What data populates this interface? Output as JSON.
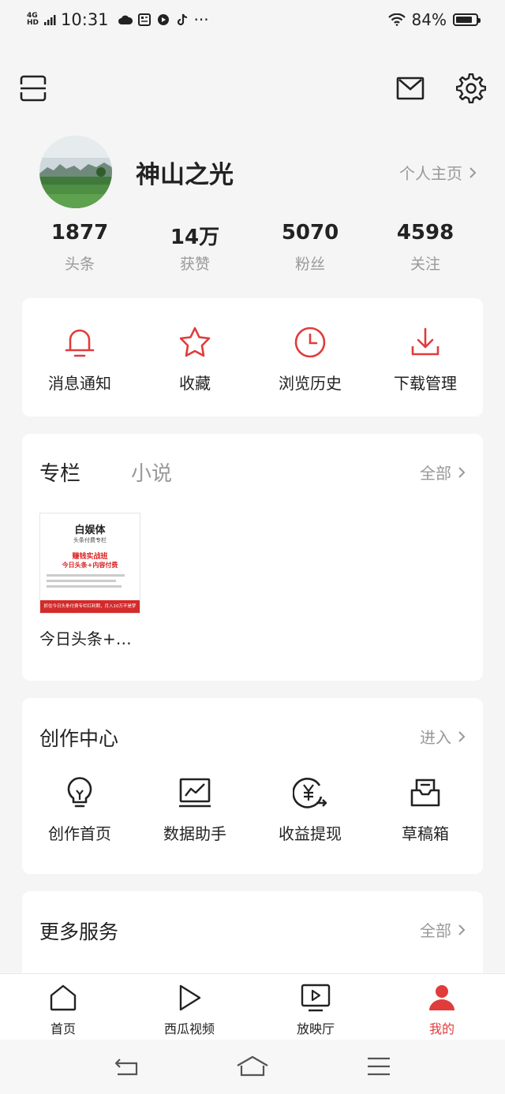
{
  "status_bar": {
    "network": "4G",
    "network_sub": "HD",
    "time": "10:31",
    "more": "···",
    "battery": "84%",
    "battery_level": 0.84
  },
  "header": {
    "left_icon": "scan-icon",
    "mail_icon": "mail-icon",
    "settings_icon": "gear-icon"
  },
  "profile": {
    "name": "神山之光",
    "homepage_label": "个人主页",
    "stats": [
      {
        "value": "1877",
        "label": "头条"
      },
      {
        "value": "14万",
        "label": "获赞"
      },
      {
        "value": "5070",
        "label": "粉丝"
      },
      {
        "value": "4598",
        "label": "关注"
      }
    ]
  },
  "quick_actions": [
    {
      "label": "消息通知",
      "icon": "bell-icon"
    },
    {
      "label": "收藏",
      "icon": "star-icon"
    },
    {
      "label": "浏览历史",
      "icon": "clock-icon"
    },
    {
      "label": "下载管理",
      "icon": "download-icon"
    }
  ],
  "column_card": {
    "tab_active": "专栏",
    "tab_inactive": "小说",
    "all_label": "全部",
    "book": {
      "title": "今日头条+…",
      "cover_brand": "白娱体",
      "cover_sub": "头条付费专栏",
      "cover_heading1": "赚钱实战班",
      "cover_heading2": "今日头条+内容付费",
      "cover_footer": "抓住今日头条付费专栏红利期，月入10万不是梦"
    }
  },
  "creator_center": {
    "title": "创作中心",
    "enter_label": "进入",
    "items": [
      {
        "label": "创作首页",
        "icon": "bulb-icon"
      },
      {
        "label": "数据助手",
        "icon": "chart-icon"
      },
      {
        "label": "收益提现",
        "icon": "yuan-icon"
      },
      {
        "label": "草稿箱",
        "icon": "drafts-icon"
      }
    ]
  },
  "more_services": {
    "title": "更多服务",
    "all_label": "全部"
  },
  "bottom_nav": [
    {
      "label": "首页",
      "icon": "home-icon",
      "active": false
    },
    {
      "label": "西瓜视频",
      "icon": "play-icon",
      "active": false
    },
    {
      "label": "放映厅",
      "icon": "tv-icon",
      "active": false
    },
    {
      "label": "我的",
      "icon": "person-icon",
      "active": true
    }
  ],
  "colors": {
    "accent": "#e03c3c",
    "text": "#222222",
    "secondary": "#999999",
    "background": "#f5f5f5"
  }
}
